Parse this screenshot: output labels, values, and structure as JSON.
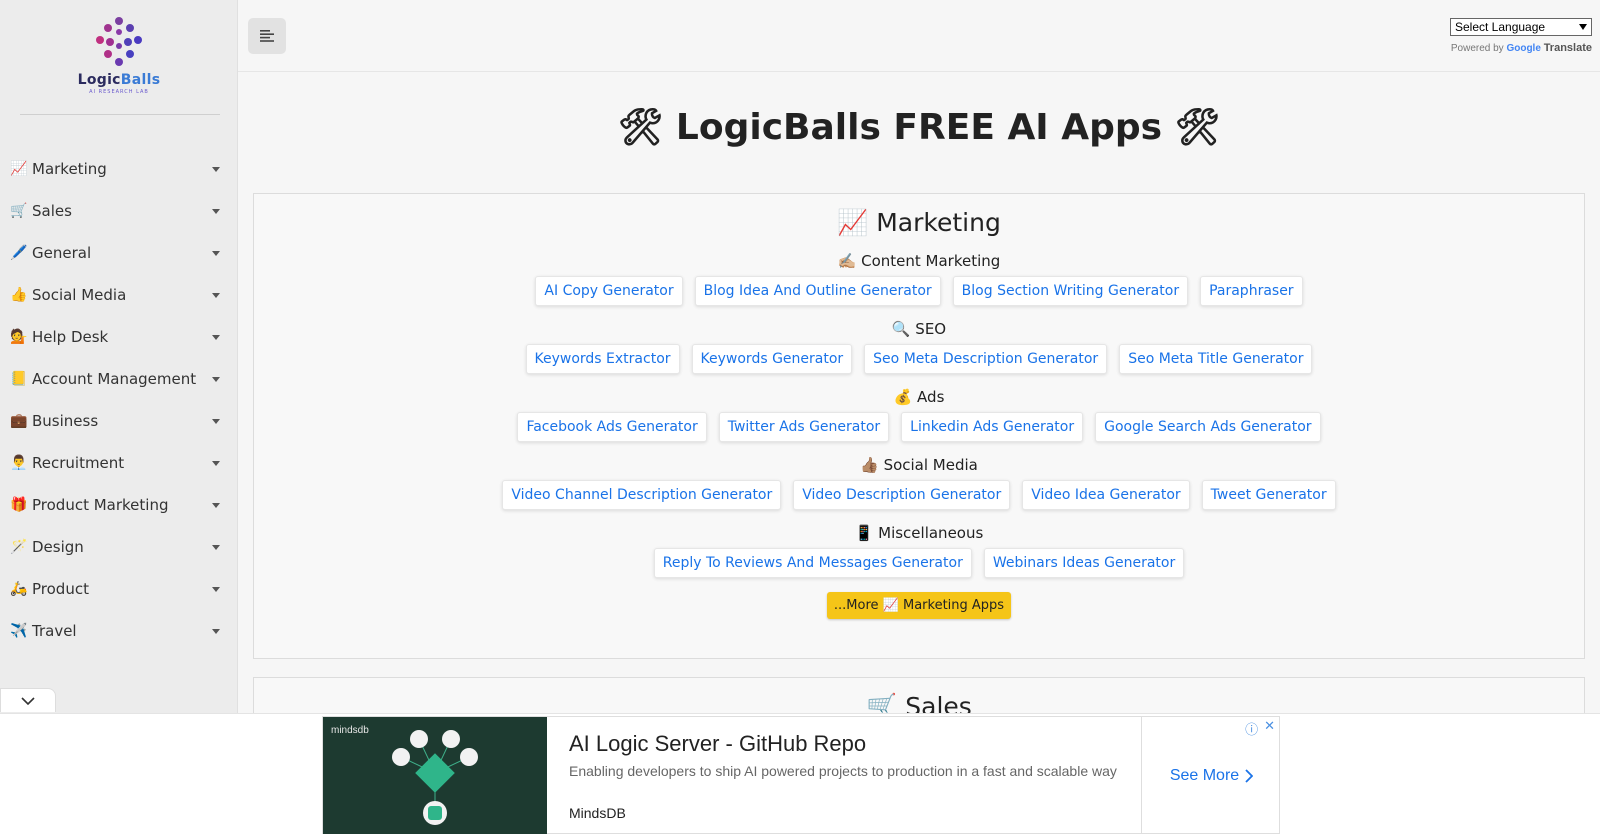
{
  "logo": {
    "name_part1": "Logic",
    "name_part2": "Balls",
    "tagline": "AI RESEARCH LAB"
  },
  "sidebar": {
    "items": [
      {
        "emoji": "📈",
        "label": "Marketing"
      },
      {
        "emoji": "🛒",
        "label": "Sales"
      },
      {
        "emoji": "🖊️",
        "label": "General"
      },
      {
        "emoji": "👍",
        "label": "Social Media"
      },
      {
        "emoji": "💁",
        "label": "Help Desk"
      },
      {
        "emoji": "📒",
        "label": "Account Management"
      },
      {
        "emoji": "💼",
        "label": "Business"
      },
      {
        "emoji": "👨‍💼",
        "label": "Recruitment"
      },
      {
        "emoji": "🎁",
        "label": "Product Marketing"
      },
      {
        "emoji": "🪄",
        "label": "Design"
      },
      {
        "emoji": "🛵",
        "label": "Product"
      },
      {
        "emoji": "✈️",
        "label": "Travel"
      }
    ]
  },
  "header": {
    "language_select": "Select Language",
    "powered_by": "Powered by",
    "google": "Google",
    "translate": "Translate"
  },
  "page_title": "🛠 LogicBalls FREE AI Apps 🛠",
  "marketing": {
    "title": "📈 Marketing",
    "sections": [
      {
        "title": "✍🏼 Content Marketing",
        "apps": [
          "AI Copy Generator",
          "Blog Idea And Outline Generator",
          "Blog Section Writing Generator",
          "Paraphraser"
        ]
      },
      {
        "title": "🔍 SEO",
        "apps": [
          "Keywords Extractor",
          "Keywords Generator",
          "Seo Meta Description Generator",
          "Seo Meta Title Generator"
        ]
      },
      {
        "title": "💰 Ads",
        "apps": [
          "Facebook Ads Generator",
          "Twitter Ads Generator",
          "Linkedin Ads Generator",
          "Google Search Ads Generator"
        ]
      },
      {
        "title": "👍🏽 Social Media",
        "apps": [
          "Video Channel Description Generator",
          "Video Description Generator",
          "Video Idea Generator",
          "Tweet Generator"
        ]
      },
      {
        "title": "📱 Miscellaneous",
        "apps": [
          "Reply To Reviews And Messages Generator",
          "Webinars Ideas Generator"
        ]
      }
    ],
    "more_button": "...More 📈 Marketing Apps"
  },
  "sales": {
    "title": "🛒 Sales"
  },
  "ad": {
    "brand": "mindsdb",
    "title": "AI Logic Server - GitHub Repo",
    "description": "Enabling developers to ship AI powered projects to production in a fast and scalable way",
    "advertiser": "MindsDB",
    "cta": "See More"
  },
  "colors": {
    "link": "#1a73e8",
    "accent_button": "#f5c518",
    "sidebar_bg": "#ececec"
  }
}
